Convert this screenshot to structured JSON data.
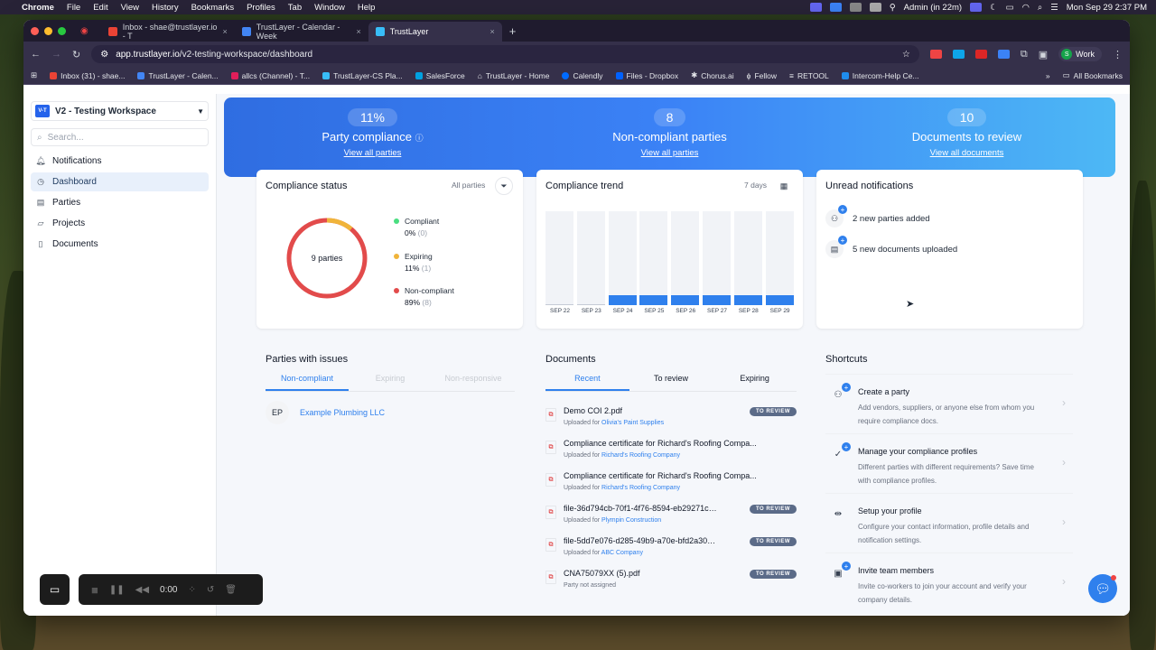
{
  "menubar": {
    "app": "Chrome",
    "items": [
      "File",
      "Edit",
      "View",
      "History",
      "Bookmarks",
      "Profiles",
      "Tab",
      "Window",
      "Help"
    ],
    "status": "Admin (in 22m)",
    "datetime": "Mon Sep 29  2:37 PM"
  },
  "browser": {
    "tabs": [
      {
        "label": "Inbox - shae@trustlayer.io - T"
      },
      {
        "label": "TrustLayer - Calendar - Week"
      },
      {
        "label": "TrustLayer"
      }
    ],
    "url": "app.trustlayer.io",
    "url_path": "/v2-testing-workspace/dashboard",
    "profile": "Work",
    "profile_initial": "S",
    "bookmarks": [
      "Inbox (31) - shae...",
      "TrustLayer - Calen...",
      "allcs (Channel) - T...",
      "TrustLayer-CS Pla...",
      "SalesForce",
      "TrustLayer - Home",
      "Calendly",
      "Files - Dropbox",
      "Chorus.ai",
      "Fellow",
      "RETOOL",
      "Intercom-Help Ce..."
    ],
    "all_bookmarks": "All Bookmarks"
  },
  "sidebar": {
    "workspace_badge": "V-T",
    "workspace": "V2 - Testing Workspace",
    "search_placeholder": "Search...",
    "items": [
      {
        "label": "Notifications"
      },
      {
        "label": "Dashboard"
      },
      {
        "label": "Parties"
      },
      {
        "label": "Projects"
      },
      {
        "label": "Documents"
      }
    ]
  },
  "banner": {
    "kpis": [
      {
        "value": "11%",
        "label": "Party compliance",
        "link": "View all parties"
      },
      {
        "value": "8",
        "label": "Non-compliant parties",
        "link": "View all parties"
      },
      {
        "value": "10",
        "label": "Documents to review",
        "link": "View all documents"
      }
    ]
  },
  "compliance_status": {
    "title": "Compliance status",
    "filter": "All parties",
    "center": "9 parties",
    "legend": [
      {
        "label": "Compliant",
        "value": "0%",
        "count": "(0)",
        "color": "#4ade80"
      },
      {
        "label": "Expiring",
        "value": "11%",
        "count": "(1)",
        "color": "#f0b43a"
      },
      {
        "label": "Non-compliant",
        "value": "89%",
        "count": "(8)",
        "color": "#e24b4b"
      }
    ]
  },
  "compliance_trend": {
    "title": "Compliance trend",
    "range": "7 days"
  },
  "chart_data": {
    "type": "bar",
    "categories": [
      "SEP 22",
      "SEP 23",
      "SEP 24",
      "SEP 25",
      "SEP 26",
      "SEP 27",
      "SEP 28",
      "SEP 29"
    ],
    "values": [
      0,
      0,
      11,
      11,
      11,
      11,
      11,
      11
    ],
    "ylim": [
      0,
      100
    ],
    "color": "#2f80ed"
  },
  "notifications": {
    "title": "Unread notifications",
    "items": [
      {
        "label": "2 new parties added",
        "icon": "user-icon"
      },
      {
        "label": "5 new documents uploaded",
        "icon": "document-icon"
      }
    ]
  },
  "parties_issues": {
    "title": "Parties with issues",
    "tabs": [
      "Non-compliant",
      "Expiring",
      "Non-responsive"
    ],
    "rows": [
      {
        "initials": "EP",
        "name": "Example Plumbing LLC"
      }
    ]
  },
  "documents": {
    "title": "Documents",
    "tabs": [
      "Recent",
      "To review",
      "Expiring"
    ],
    "items": [
      {
        "name": "Demo COI 2.pdf",
        "prefix": "Uploaded for",
        "party": "Olivia's Paint Supplies",
        "tag": "TO REVIEW"
      },
      {
        "name": "Compliance certificate for Richard's Roofing Compa...",
        "prefix": "Uploaded for",
        "party": "Richard's Roofing Company",
        "tag": ""
      },
      {
        "name": "Compliance certificate for Richard's Roofing Compa...",
        "prefix": "Uploaded for",
        "party": "Richard's Roofing Company",
        "tag": ""
      },
      {
        "name": "file-36d794cb-70f1-4f76-8594-eb29271c9be...",
        "prefix": "Uploaded for",
        "party": "Plympin Construction",
        "tag": "TO REVIEW"
      },
      {
        "name": "file-5dd7e076-d285-49b9-a70e-bfd2a30d60...",
        "prefix": "Uploaded for",
        "party": "ABC Company",
        "tag": "TO REVIEW"
      },
      {
        "name": "CNA75079XX (5).pdf",
        "prefix": "Party not assigned",
        "party": "",
        "tag": "TO REVIEW"
      }
    ]
  },
  "shortcuts": {
    "title": "Shortcuts",
    "items": [
      {
        "title": "Create a party",
        "desc": "Add vendors, suppliers, or anyone else from whom you require compliance docs."
      },
      {
        "title": "Manage your compliance profiles",
        "desc": "Different parties with different requirements? Save time with compliance profiles."
      },
      {
        "title": "Setup your profile",
        "desc": "Configure your contact information, profile details and notification settings."
      },
      {
        "title": "Invite team members",
        "desc": "Invite co-workers to join your account and verify your company details."
      }
    ]
  },
  "recorder": {
    "time": "0:00"
  }
}
